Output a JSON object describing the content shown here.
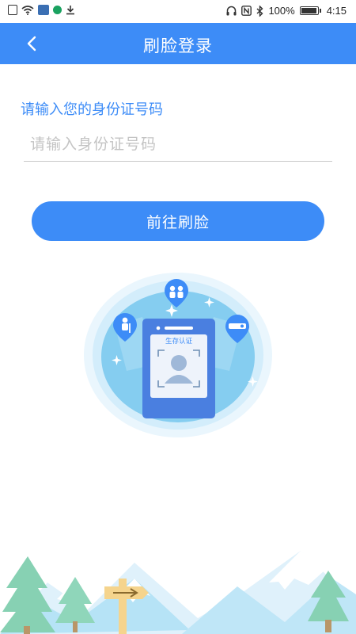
{
  "status_bar": {
    "battery_level": "100%",
    "time": "4:15",
    "icons": [
      "sim-icon",
      "wifi-icon",
      "app-icon",
      "wechat-icon",
      "download-icon",
      "headset-icon",
      "nfc-icon",
      "bluetooth-icon",
      "battery-icon"
    ]
  },
  "app_bar": {
    "back_icon": "chevron-left-icon",
    "title": "刷脸登录"
  },
  "form": {
    "label": "请输入您的身份证号码",
    "placeholder": "请输入身份证号码",
    "value": ""
  },
  "actions": {
    "go_face_label": "前往刷脸"
  },
  "illustration": {
    "card_label": "生存认证"
  },
  "colors": {
    "accent": "#3d8cf7",
    "label_blue": "#3d8cf7",
    "placeholder_gray": "#c4c4c4"
  }
}
